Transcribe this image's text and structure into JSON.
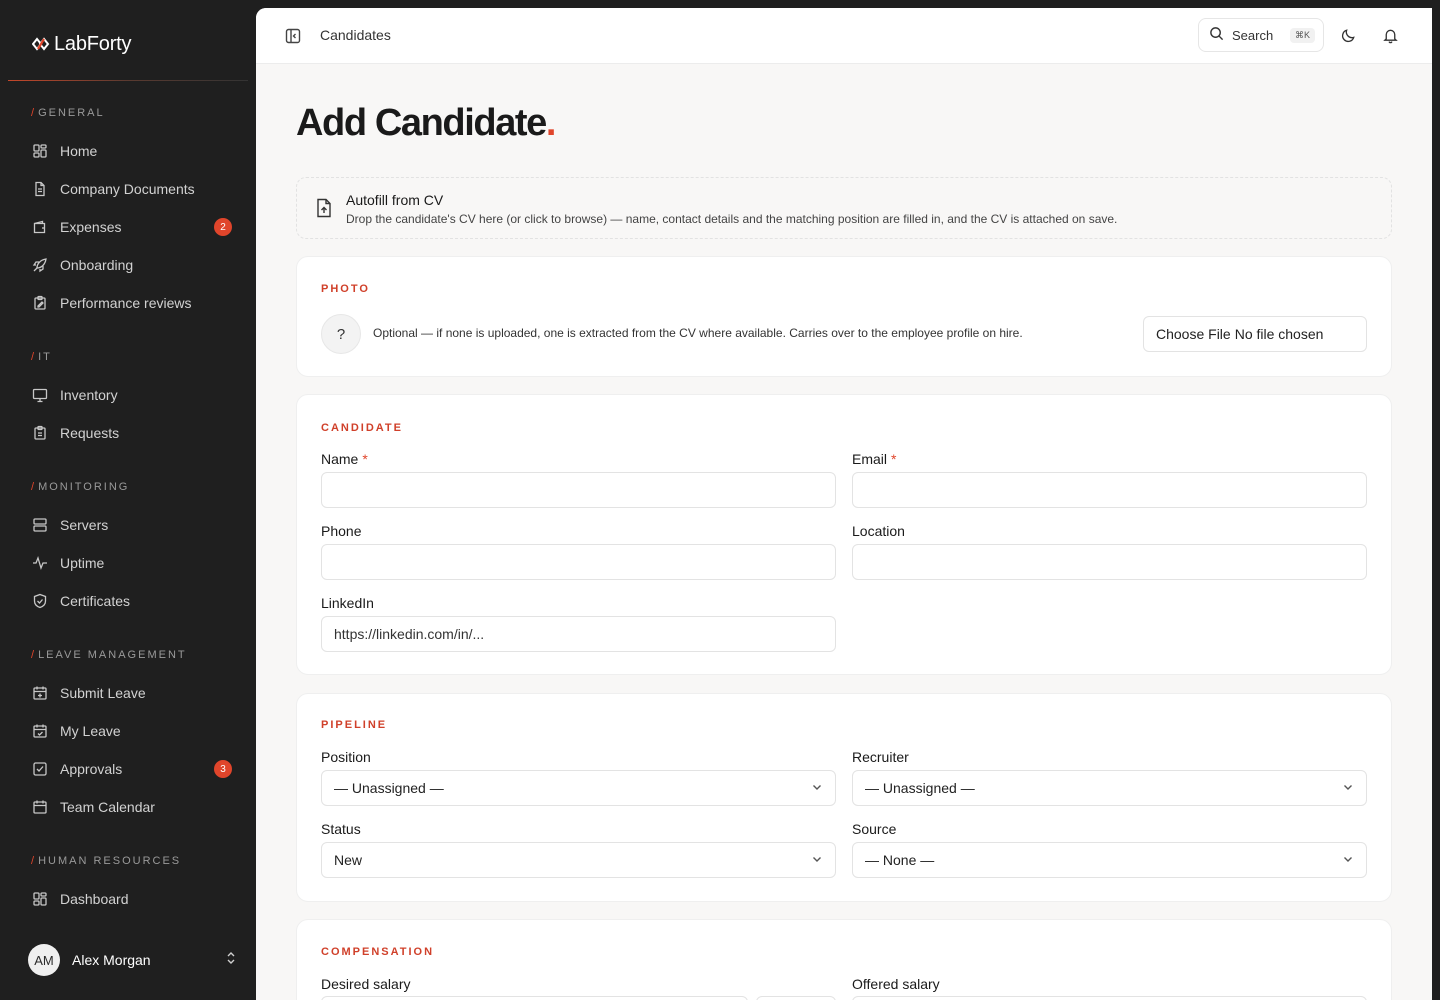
{
  "app": {
    "name": "LabForty"
  },
  "sidebar": {
    "sections": [
      {
        "label": "General",
        "items": [
          {
            "label": "Home",
            "icon": "grid-icon"
          },
          {
            "label": "Company Documents",
            "icon": "document-icon"
          },
          {
            "label": "Expenses",
            "icon": "wallet-icon",
            "badge": "2"
          },
          {
            "label": "Onboarding",
            "icon": "rocket-icon"
          },
          {
            "label": "Performance reviews",
            "icon": "clipboard-edit-icon"
          }
        ]
      },
      {
        "label": "IT",
        "items": [
          {
            "label": "Inventory",
            "icon": "monitor-icon"
          },
          {
            "label": "Requests",
            "icon": "clipboard-list-icon"
          }
        ]
      },
      {
        "label": "Monitoring",
        "items": [
          {
            "label": "Servers",
            "icon": "server-icon"
          },
          {
            "label": "Uptime",
            "icon": "activity-icon"
          },
          {
            "label": "Certificates",
            "icon": "shield-icon"
          }
        ]
      },
      {
        "label": "Leave Management",
        "items": [
          {
            "label": "Submit Leave",
            "icon": "calendar-plus-icon"
          },
          {
            "label": "My Leave",
            "icon": "calendar-check-icon"
          },
          {
            "label": "Approvals",
            "icon": "check-square-icon",
            "badge": "3"
          },
          {
            "label": "Team Calendar",
            "icon": "calendar-icon"
          }
        ]
      },
      {
        "label": "Human Resources",
        "items": [
          {
            "label": "Dashboard",
            "icon": "grid-icon"
          }
        ]
      }
    ],
    "user": {
      "initials": "AM",
      "name": "Alex Morgan"
    }
  },
  "topbar": {
    "breadcrumb": "Candidates",
    "search_label": "Search",
    "search_shortcut": "⌘K"
  },
  "page": {
    "title": "Add Candidate",
    "title_dot": "."
  },
  "autofill": {
    "title": "Autofill from CV",
    "description": "Drop the candidate's CV here (or click to browse) — name, contact details and the matching position are filled in, and the CV is attached on save."
  },
  "photo": {
    "section_label": "PHOTO",
    "placeholder_glyph": "?",
    "description": "Optional — if none is uploaded, one is extracted from the CV where available. Carries over to the employee profile on hire.",
    "file_button": "Choose File",
    "file_status": "No file chosen"
  },
  "candidate": {
    "section_label": "CANDIDATE",
    "name_label": "Name",
    "email_label": "Email",
    "phone_label": "Phone",
    "location_label": "Location",
    "linkedin_label": "LinkedIn",
    "linkedin_placeholder": "https://linkedin.com/in/...",
    "required_mark": "*"
  },
  "pipeline": {
    "section_label": "PIPELINE",
    "position_label": "Position",
    "position_value": "— Unassigned —",
    "recruiter_label": "Recruiter",
    "recruiter_value": "— Unassigned —",
    "status_label": "Status",
    "status_value": "New",
    "source_label": "Source",
    "source_value": "— None —"
  },
  "compensation": {
    "section_label": "COMPENSATION",
    "desired_label": "Desired salary",
    "offered_label": "Offered salary"
  },
  "colors": {
    "accent": "#e0452b",
    "sidebar_bg": "#1f1f1f",
    "page_bg": "#f8f7f6"
  }
}
